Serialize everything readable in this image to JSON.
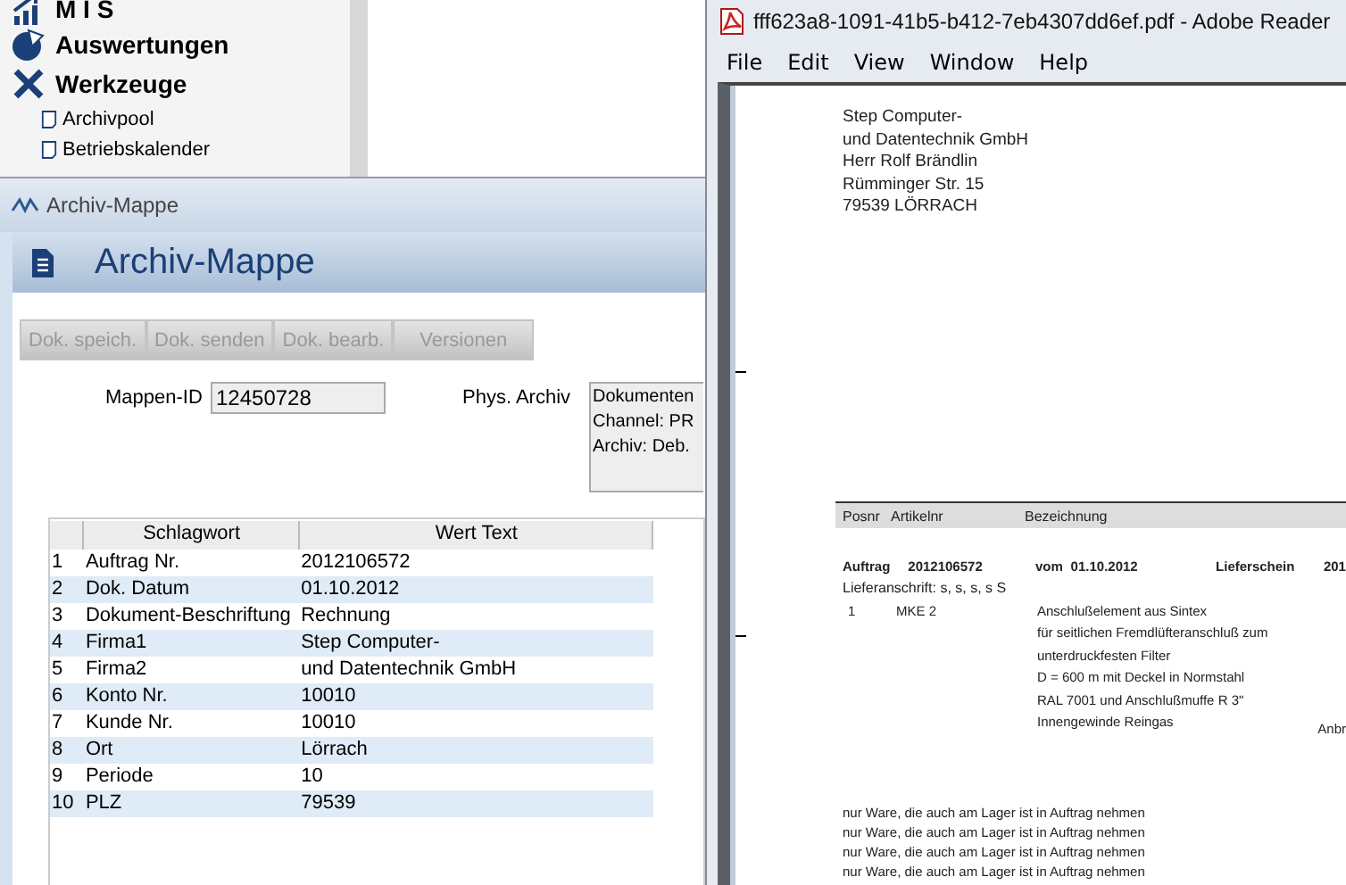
{
  "nav": {
    "items": [
      {
        "label": "M I S",
        "kind": "chart"
      },
      {
        "label": "Auswertungen",
        "kind": "pie"
      },
      {
        "label": "Werkzeuge",
        "kind": "tools"
      },
      {
        "label": "Archivpool",
        "kind": "doc"
      },
      {
        "label": "Betriebskalender",
        "kind": "doc"
      }
    ]
  },
  "archive_window": {
    "title": "Archiv-Mappe",
    "heading": "Archiv-Mappe",
    "toolbar": [
      {
        "label": "Dok. speich.",
        "disabled": true
      },
      {
        "label": "Dok. senden",
        "disabled": true
      },
      {
        "label": "Dok. bearb.",
        "disabled": true
      },
      {
        "label": "Versionen",
        "disabled": true
      }
    ],
    "mappen_id": {
      "label": "Mappen-ID",
      "value": "12450728"
    },
    "phys_archiv": {
      "label": "Phys. Archiv",
      "lines": [
        "Dokumenten",
        "Channel: PR",
        "Archiv: Deb."
      ]
    },
    "table": {
      "columns": [
        "Schlagwort",
        "Wert Text"
      ],
      "rows": [
        [
          "1",
          "Auftrag Nr.",
          "2012106572"
        ],
        [
          "2",
          "Dok. Datum",
          "01.10.2012"
        ],
        [
          "3",
          "Dokument-Beschriftung",
          "Rechnung"
        ],
        [
          "4",
          "Firma1",
          "Step Computer-"
        ],
        [
          "5",
          "Firma2",
          "und Datentechnik GmbH"
        ],
        [
          "6",
          "Konto Nr.",
          "10010"
        ],
        [
          "7",
          "Kunde Nr.",
          "10010"
        ],
        [
          "8",
          "Ort",
          "Lörrach"
        ],
        [
          "9",
          "Periode",
          "10"
        ],
        [
          "10",
          "PLZ",
          "79539"
        ]
      ]
    }
  },
  "reader_window": {
    "title": "fff623a8-1091-41b5-b412-7eb4307dd6ef.pdf - Adobe Reader",
    "menu": [
      "File",
      "Edit",
      "View",
      "Window",
      "Help"
    ],
    "document": {
      "address": [
        "Step Computer-",
        "und Datentechnik GmbH",
        "Herr Rolf Brändlin",
        "Rümminger Str. 15",
        "79539 LÖRRACH"
      ],
      "columns": [
        "Posnr",
        "Artikelnr",
        "Bezeichnung"
      ],
      "order_line": [
        "Auftrag",
        "2012106572",
        "vom",
        "01.10.2012",
        "Lieferschein",
        "201"
      ],
      "delivery_address": "Lieferanschrift: s, s, s, s S",
      "position": {
        "number": "1",
        "article": "MKE 2",
        "description": [
          "Anschlußelement aus Sintex",
          "für seitlichen Fremdlüfteranschluß zum",
          "unterdruckfesten Filter",
          "D = 600 m mit Deckel in Normstahl",
          "RAL 7001 und Anschlußmuffe R 3\"",
          "Innengewinde Reingas"
        ]
      },
      "side_text": "Anbr",
      "notes": [
        "nur Ware, die auch am Lager ist in Auftrag nehmen",
        "nur Ware, die auch am Lager ist in Auftrag nehmen",
        "nur Ware, die auch am Lager ist in Auftrag nehmen",
        "nur Ware, die auch am Lager ist in Auftrag nehmen"
      ]
    }
  }
}
